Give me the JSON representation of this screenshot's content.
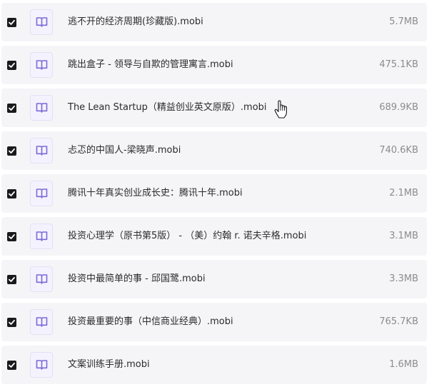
{
  "files": [
    {
      "name": "逃不开的经济周期(珍藏版).mobi",
      "size": "5.7MB",
      "checked": true,
      "icon": "book-icon"
    },
    {
      "name": "跳出盒子 - 领导与自欺的管理寓言.mobi",
      "size": "475.1KB",
      "checked": true,
      "icon": "book-icon"
    },
    {
      "name": "The Lean Startup（精益创业英文原版）.mobi",
      "size": "689.9KB",
      "checked": true,
      "icon": "book-icon"
    },
    {
      "name": "忐忑的中国人-梁晓声.mobi",
      "size": "740.6KB",
      "checked": true,
      "icon": "book-icon"
    },
    {
      "name": "腾讯十年真实创业成长史：腾讯十年.mobi",
      "size": "2.1MB",
      "checked": true,
      "icon": "book-icon"
    },
    {
      "name": "投资心理学（原书第5版） - （美）约翰 r. 诺夫辛格.mobi",
      "size": "3.1MB",
      "checked": true,
      "icon": "book-icon"
    },
    {
      "name": "投资中最简单的事 - 邱国鹭.mobi",
      "size": "3.3MB",
      "checked": true,
      "icon": "book-icon"
    },
    {
      "name": "投资最重要的事（中信商业经典）.mobi",
      "size": "765.7KB",
      "checked": true,
      "icon": "book-icon"
    },
    {
      "name": "文案训练手册.mobi",
      "size": "1.6MB",
      "checked": true,
      "icon": "book-icon"
    }
  ]
}
